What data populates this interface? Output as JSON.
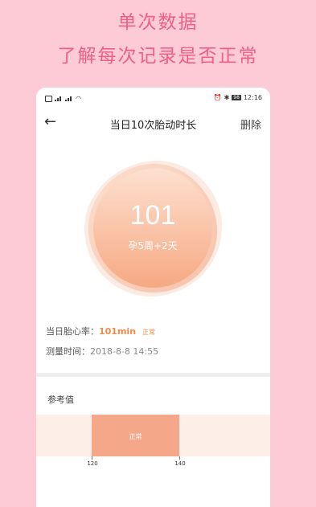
{
  "hero": {
    "title": "单次数据",
    "subtitle": "了解每次记录是否正常"
  },
  "status_bar": {
    "time": "12:16",
    "battery": "98"
  },
  "nav": {
    "title": "当日10次胎动时长",
    "action": "删除"
  },
  "summary": {
    "value": "101",
    "gestation": "孕5周+2天"
  },
  "details": {
    "heart_rate_label": "当日胎心率：",
    "heart_rate_value": "101min",
    "heart_rate_status": "正常",
    "time_label": "测量时间：",
    "time_value": "2018-8-8  14:55"
  },
  "reference": {
    "label": "参考值",
    "normal_label": "正常",
    "low": "120",
    "high": "140"
  },
  "colors": {
    "accent": "#f08a4b",
    "hero_text": "#ef5f86",
    "background": "#fccbd6"
  }
}
